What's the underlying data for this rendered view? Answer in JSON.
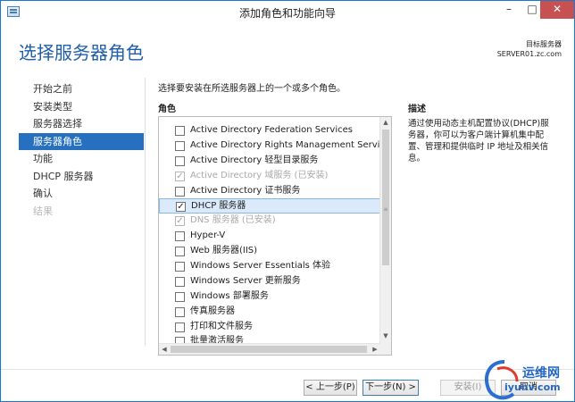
{
  "window": {
    "title": "添加角色和功能向导",
    "minimize_glyph": "–",
    "maximize_glyph": "□",
    "close_glyph": "✕"
  },
  "header": {
    "page_title": "选择服务器角色",
    "target_label": "目标服务器",
    "target_server": "SERVER01.zc.com"
  },
  "nav": {
    "items": [
      {
        "label": "开始之前",
        "state": "normal"
      },
      {
        "label": "安装类型",
        "state": "normal"
      },
      {
        "label": "服务器选择",
        "state": "normal"
      },
      {
        "label": "服务器角色",
        "state": "active"
      },
      {
        "label": "功能",
        "state": "normal"
      },
      {
        "label": "DHCP 服务器",
        "state": "normal"
      },
      {
        "label": "确认",
        "state": "normal"
      },
      {
        "label": "结果",
        "state": "disabled"
      }
    ]
  },
  "main": {
    "instruction": "选择要安装在所选服务器上的一个或多个角色。",
    "roles_header": "角色",
    "roles": [
      {
        "label": "Active Directory Federation Services",
        "checked": false,
        "disabled": false
      },
      {
        "label": "Active Directory Rights Management Services",
        "checked": false,
        "disabled": false
      },
      {
        "label": "Active Directory 轻型目录服务",
        "checked": false,
        "disabled": false
      },
      {
        "label": "Active Directory 域服务 (已安装)",
        "checked": true,
        "disabled": true
      },
      {
        "label": "Active Directory 证书服务",
        "checked": false,
        "disabled": false
      },
      {
        "label": "DHCP 服务器",
        "checked": true,
        "disabled": false,
        "selected": true
      },
      {
        "label": "DNS 服务器 (已安装)",
        "checked": true,
        "disabled": true
      },
      {
        "label": "Hyper-V",
        "checked": false,
        "disabled": false
      },
      {
        "label": "Web 服务器(IIS)",
        "checked": false,
        "disabled": false
      },
      {
        "label": "Windows Server Essentials 体验",
        "checked": false,
        "disabled": false
      },
      {
        "label": "Windows Server 更新服务",
        "checked": false,
        "disabled": false
      },
      {
        "label": "Windows 部署服务",
        "checked": false,
        "disabled": false
      },
      {
        "label": "传真服务器",
        "checked": false,
        "disabled": false
      },
      {
        "label": "打印和文件服务",
        "checked": false,
        "disabled": false
      },
      {
        "label": "批量激活服务",
        "checked": false,
        "disabled": false
      }
    ],
    "description_header": "描述",
    "description_text": "通过使用动态主机配置协议(DHCP)服务器，你可以为客户端计算机集中配置、管理和提供临时 IP 地址及相关信息。"
  },
  "footer": {
    "prev_label": "< 上一步(P)",
    "next_label": "下一步(N) >",
    "install_label": "安装(I)",
    "cancel_label": "取消"
  },
  "watermark": {
    "cn": "运维网",
    "url": "iyunv.com"
  },
  "colors": {
    "accent": "#2670bf",
    "title_blue": "#1f5ea8",
    "selection_bg": "#dbeafa",
    "close_red": "#c75050"
  }
}
